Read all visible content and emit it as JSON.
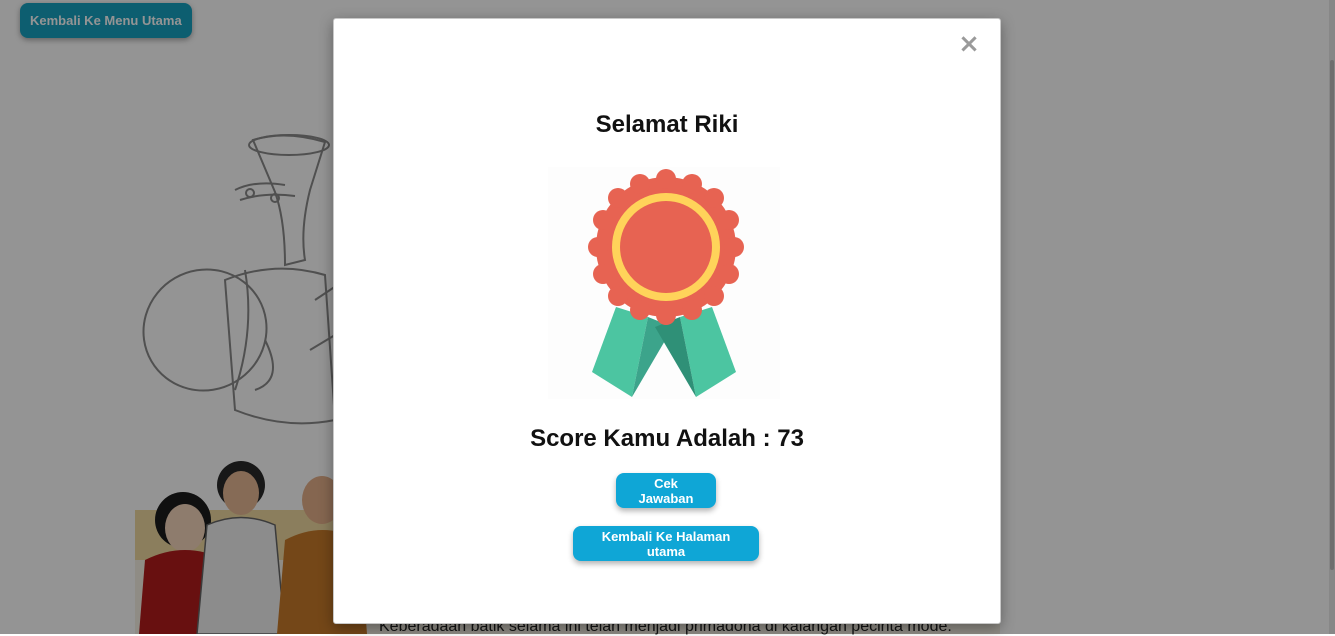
{
  "header": {
    "back_label": "Kembali Ke Menu Utama"
  },
  "background": {
    "paragraph": "Keberadaan batik selama ini telah menjadi primadona di kalangan pecinta mode."
  },
  "modal": {
    "close_glyph": "×",
    "title": "Selamat Riki",
    "award_icon": "award-ribbon-icon",
    "score_label": "Score Kamu Adalah : ",
    "score_value": "73",
    "check_label": "Cek Jawaban",
    "home_label": "Kembali Ke Halaman utama"
  },
  "colors": {
    "button": "#0fa6d6",
    "medal_outer": "#e76352",
    "medal_ring": "#ffd35a",
    "ribbon": "#4cc5a1",
    "ribbon_dark": "#34a389"
  }
}
